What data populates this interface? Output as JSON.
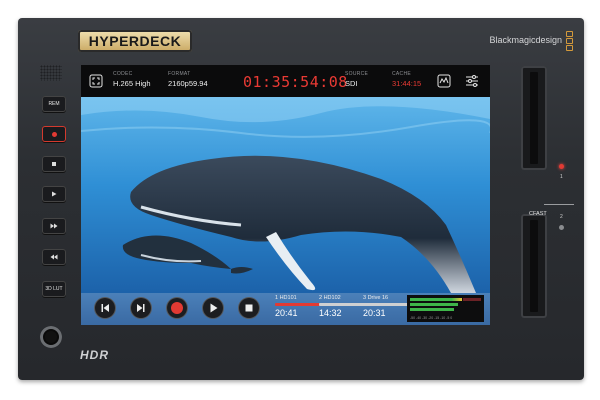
{
  "device": {
    "product_logo": "HYPERDECK",
    "brand": "Blackmagicdesign",
    "hdr_logo": "HDR",
    "slot_label": "CFAST",
    "slot_numbers": [
      "1",
      "2"
    ],
    "accent_red": "#ea3a34",
    "buttons": [
      {
        "label": "REM",
        "icon": ""
      },
      {
        "label": "",
        "icon": "record-icon"
      },
      {
        "label": "",
        "icon": "stop-icon"
      },
      {
        "label": "",
        "icon": "play-icon"
      },
      {
        "label": "",
        "icon": "forward-icon"
      },
      {
        "label": "",
        "icon": "rewind-icon"
      },
      {
        "label": "3D LUT",
        "icon": ""
      }
    ]
  },
  "screen": {
    "topbar": {
      "codec_label": "CODEC",
      "codec_value": "H.265 High",
      "format_label": "FORMAT",
      "format_value": "2160p59.94",
      "timecode": "01:35:54:08",
      "source_label": "SOURCE",
      "source_value": "SDI",
      "cache_label": "CACHE",
      "cache_value": "31:44:15",
      "icons": [
        "fullscreen-icon",
        "waveform-icon",
        "settings-sliders-icon"
      ]
    },
    "transport": {
      "buttons": [
        "skip-back-icon",
        "skip-forward-icon",
        "record-icon",
        "play-icon",
        "stop-icon"
      ]
    },
    "clips": [
      {
        "name": "1  HD101",
        "time": "20:41",
        "active": true
      },
      {
        "name": "2  HD102",
        "time": "14:32",
        "active": false
      },
      {
        "name": "3  Drive 16",
        "time": "20:31",
        "active": false
      }
    ],
    "meter_scale": "-50 -40 -30 -20 -15 -10 -5 0"
  }
}
